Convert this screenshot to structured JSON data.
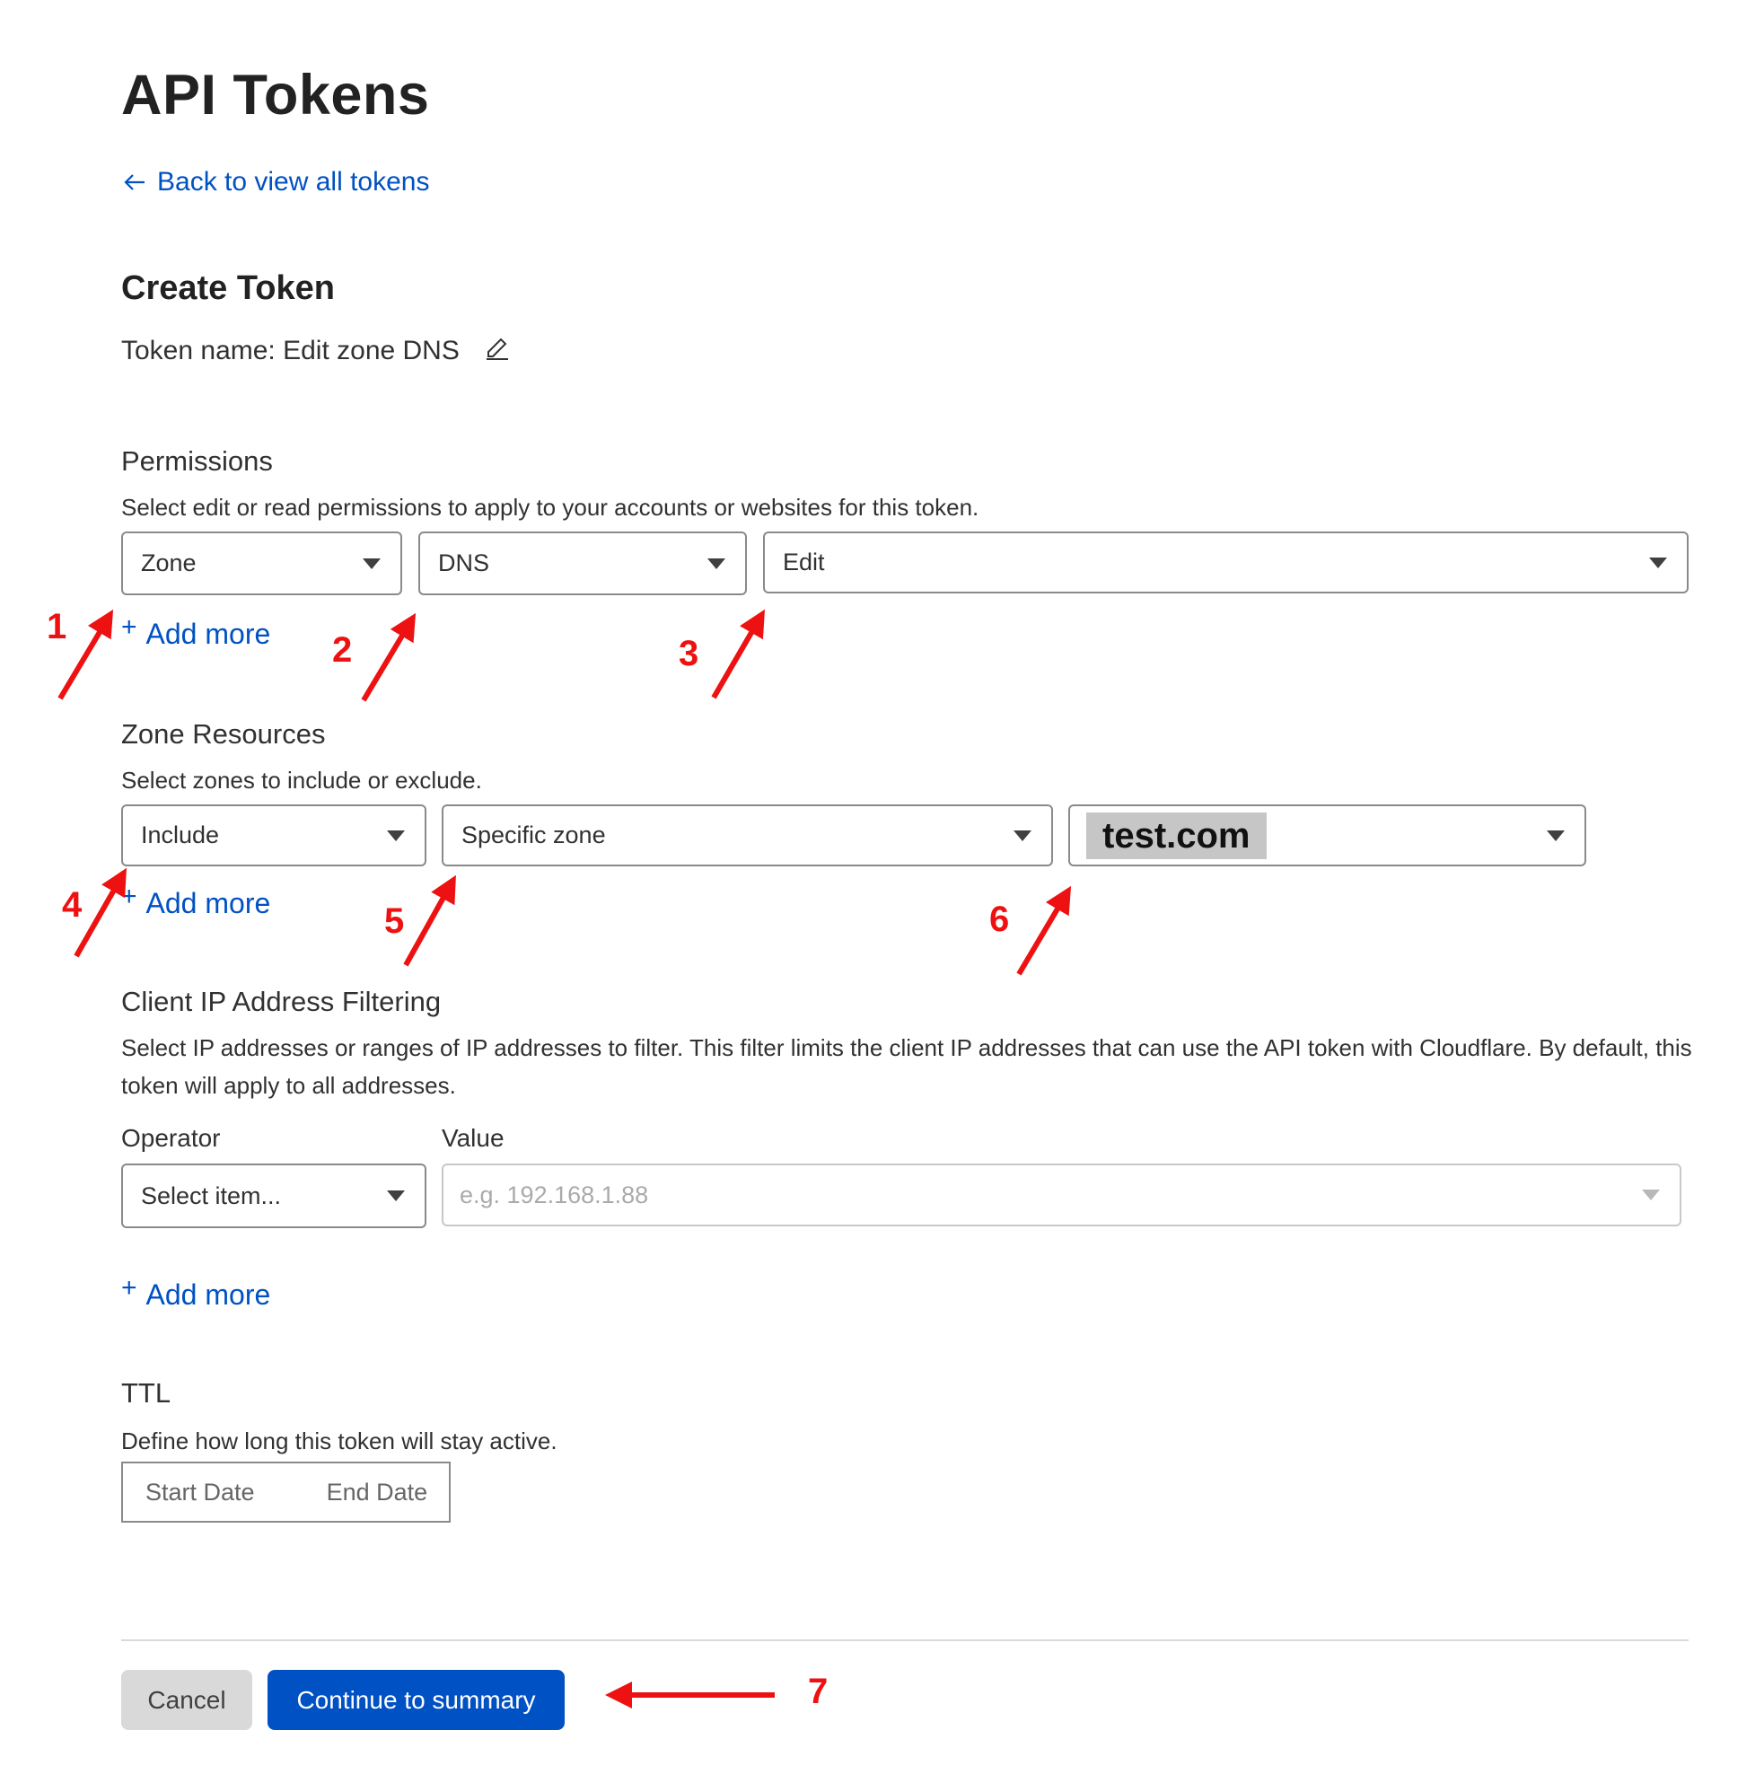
{
  "page_title": "API Tokens",
  "back_link": "Back to view all tokens",
  "create_title": "Create Token",
  "token_name": "Token name: Edit zone DNS",
  "permissions": {
    "title": "Permissions",
    "description": "Select edit or read permissions to apply to your accounts or websites for this token.",
    "scope": "Zone",
    "resource": "DNS",
    "access": "Edit",
    "add_more": "Add more"
  },
  "zone_resources": {
    "title": "Zone Resources",
    "description": "Select zones to include or exclude.",
    "mode": "Include",
    "type": "Specific zone",
    "zone": "test.com",
    "add_more": "Add more"
  },
  "ip_filtering": {
    "title": "Client IP Address Filtering",
    "description": "Select IP addresses or ranges of IP addresses to filter. This filter limits the client IP addresses that can use the API token with Cloudflare. By default, this token will apply to all addresses.",
    "operator_label": "Operator",
    "value_label": "Value",
    "operator_placeholder": "Select item...",
    "value_placeholder": "e.g. 192.168.1.88",
    "add_more": "Add more"
  },
  "ttl": {
    "title": "TTL",
    "description": "Define how long this token will stay active.",
    "start_placeholder": "Start Date",
    "end_placeholder": "End Date"
  },
  "buttons": {
    "cancel": "Cancel",
    "continue": "Continue to summary"
  },
  "annotations": [
    "1",
    "2",
    "3",
    "4",
    "5",
    "6",
    "7"
  ],
  "colors": {
    "link": "#0051c3",
    "primary_button": "#0051c3",
    "annotation": "#ee1111",
    "highlight": "#c6c6c6"
  },
  "icons": [
    "arrow-left-icon",
    "pencil-icon",
    "plus-icon",
    "caret-down-icon",
    "annotation-arrow-icon"
  ]
}
